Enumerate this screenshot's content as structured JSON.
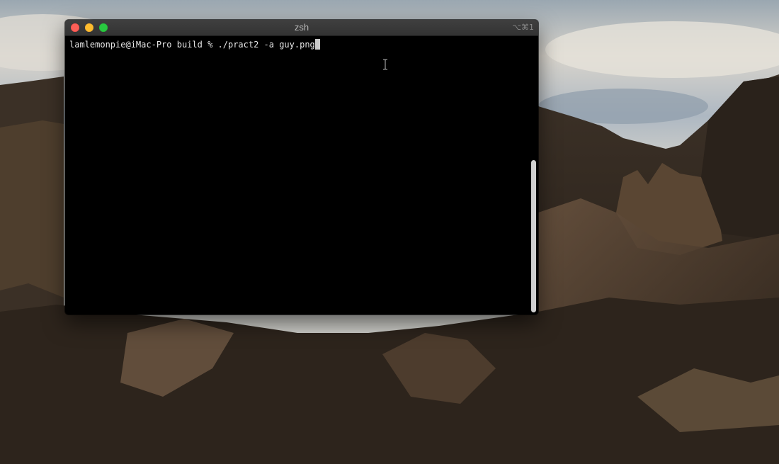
{
  "window": {
    "title": "zsh",
    "shortcut": "⌥⌘1"
  },
  "terminal": {
    "prompt": "lamlemonpie@iMac-Pro build % ",
    "command": "./pract2 -a guy.png"
  },
  "icons": {
    "close": "close-icon",
    "minimize": "minimize-icon",
    "zoom": "zoom-icon",
    "text_cursor": "ibeam-cursor-icon"
  },
  "colors": {
    "close": "#fc5f57",
    "minimize": "#fdbc2e",
    "zoom": "#28c840",
    "terminal_bg": "#000000",
    "terminal_text": "#e8e8e8"
  }
}
